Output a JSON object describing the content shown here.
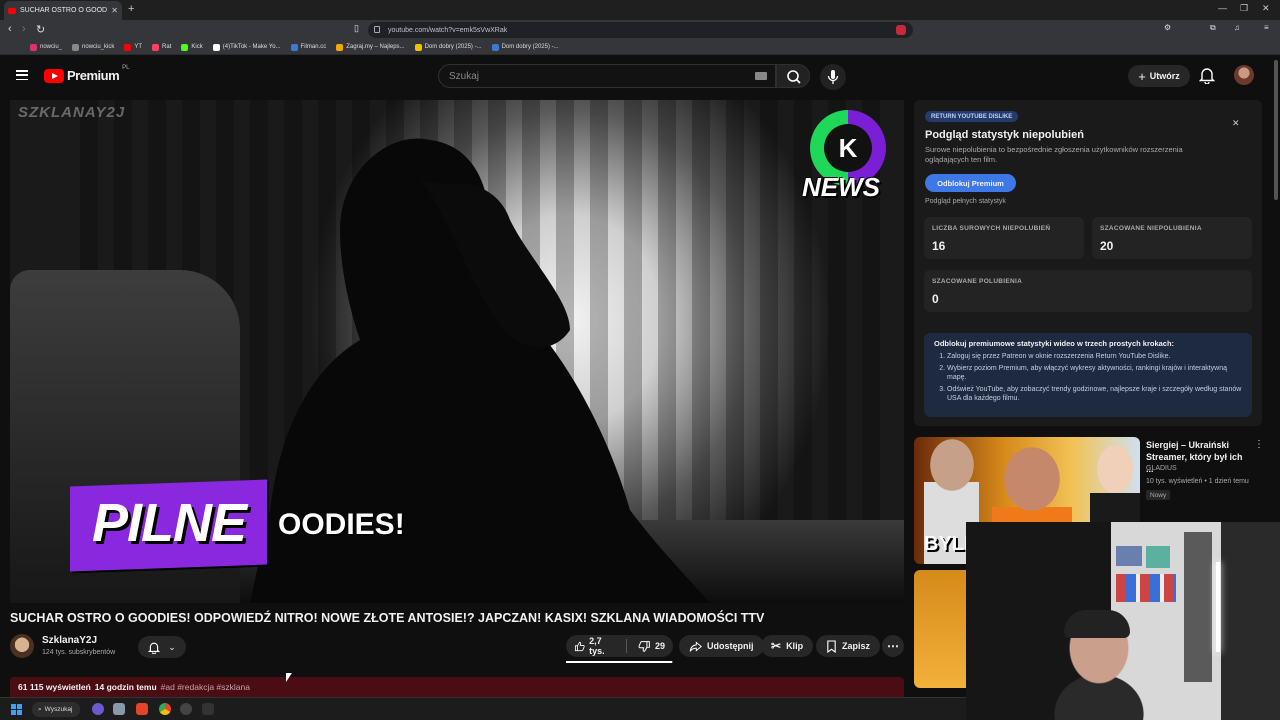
{
  "browser": {
    "tab_title": "SUCHAR OSTRO O GOODIES! O",
    "url": "youtube.com/watch?v=emk5sVwXRak",
    "bookmarks": [
      {
        "label": "nowciu_",
        "color": "#e1306c"
      },
      {
        "label": "nowciu_kick",
        "color": "#888888"
      },
      {
        "label": "YT",
        "color": "#ff0000"
      },
      {
        "label": "Rat",
        "color": "#ff4060"
      },
      {
        "label": "Kick",
        "color": "#53fc18"
      },
      {
        "label": "(4)TikTok - Make Yo...",
        "color": "#ffffff"
      },
      {
        "label": "Filman.cc",
        "color": "#3a7bd5"
      },
      {
        "label": "Zagraj.my – Najleps...",
        "color": "#f2a900"
      },
      {
        "label": "Dom dobry (2025) -...",
        "color": "#f2c200"
      },
      {
        "label": "Dom dobry (2025) -...",
        "color": "#3a7bd5"
      }
    ]
  },
  "masthead": {
    "logo_text": "Premium",
    "country_code": "PL",
    "search_placeholder": "Szukaj",
    "create_label": "Utwórz"
  },
  "video": {
    "watermark": "SZKLANAY2J",
    "news_logo_text": "NEWS",
    "news_logo_letter": "K",
    "overlay_badge": "PILNE",
    "overlay_text": "OODIES!",
    "title": "SUCHAR OSTRO O GOODIES! ODPOWIEDŹ NITRO! NOWE ZŁOTE ANTOSIE!? JAPCZAN! KASIX! SZKLANA WIADOMOŚCI TTV",
    "channel_name": "SzklanaY2J",
    "subscribers": "124 tys. subskrybentów",
    "likes": "2,7 tys.",
    "dislikes": "29",
    "like_ratio": 0.99,
    "share_label": "Udostępnij",
    "clip_label": "Klip",
    "save_label": "Zapisz",
    "views": "61 115 wyświetleń",
    "time_ago": "14 godzin temu",
    "tags": "#ad #redakcja #szklana"
  },
  "ryd": {
    "badge": "RETURN YOUTUBE DISLIKE",
    "title": "Podgląd statystyk niepolubień",
    "description": "Surowe niepolubienia to bezpośrednie zgłoszenia użytkowników rozszerzenia oglądających ten film.",
    "unlock_button": "Odblokuj Premium",
    "full_stats_link": "Podgląd pełnych statystyk",
    "stats": [
      {
        "label": "LICZBA SUROWYCH NIEPOLUBIEŃ",
        "value": "16"
      },
      {
        "label": "SZACOWANE NIEPOLUBIENIA",
        "value": "20"
      },
      {
        "label": "SZACOWANE POLUBIENIA",
        "value": "0"
      }
    ],
    "steps_heading": "Odblokuj premiumowe statystyki wideo w trzech prostych krokach:",
    "steps": [
      "Zaloguj się przez Patreon w oknie rozszerzenia Return YouTube Dislike.",
      "Wybierz poziom Premium, aby włączyć wykresy aktywności, rankingi krajów i interaktywną mapę.",
      "Odśwież YouTube, aby zobaczyć trendy godzinowe, najlepsze kraje i szczegóły według stanów USA dla każdego filmu."
    ]
  },
  "recommendation": {
    "title": "Siergiej – Ukraiński Streamer, który był ich ...",
    "channel": "GLADIUS",
    "meta": "10 tys. wyświetleń • 1 dzień temu",
    "badge": "Nowy",
    "thumb_caption": "BYLI"
  },
  "taskbar": {
    "search_label": "Wyszukaj"
  }
}
